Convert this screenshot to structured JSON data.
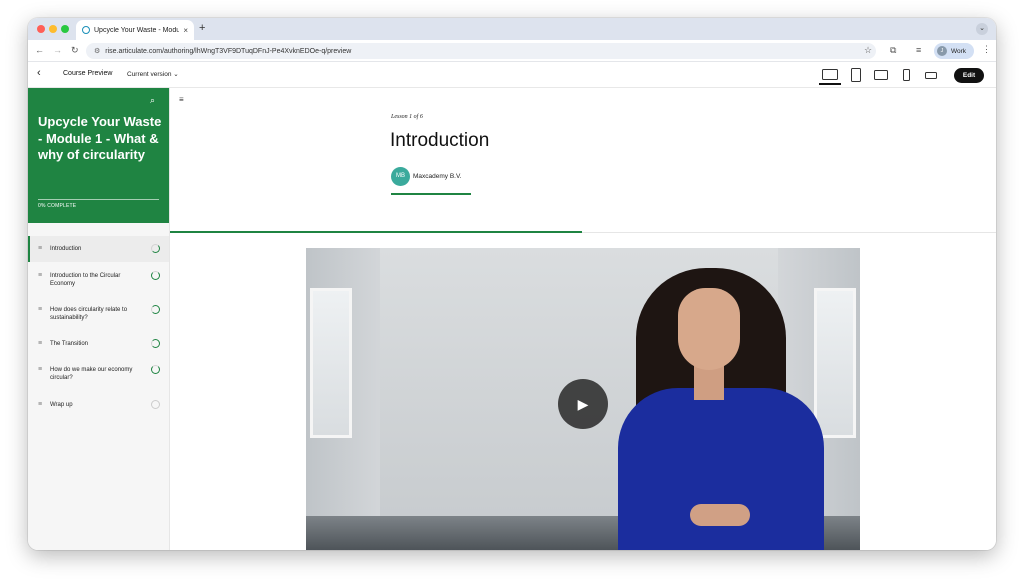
{
  "browser": {
    "tab_title": "Upcycle Your Waste - Module 1 - What & why of circularity",
    "tab_close": "×",
    "new_tab": "+",
    "url": "rise.articulate.com/authoring/lhWngT3VF9DTuqDFnJ-Pe4XvknEDOe-q/preview",
    "profile_initial": "J",
    "profile_name": "Work"
  },
  "app_header": {
    "title": "Course Preview",
    "version": "Current version",
    "edit_label": "Edit",
    "devices": [
      "desktop",
      "tablet-portrait",
      "tablet-landscape",
      "phone-portrait",
      "phone-landscape"
    ]
  },
  "sidebar": {
    "course_title": "Upcycle Your Waste - Module 1 - What & why of circularity",
    "progress": "0% COMPLETE",
    "progress_value": 0,
    "lessons": [
      {
        "label": "Introduction",
        "active": true
      },
      {
        "label": "Introduction to the Circular Economy"
      },
      {
        "label": "How does circularity relate to sustainability?"
      },
      {
        "label": "The Transition"
      },
      {
        "label": "How do we make our economy circular?"
      },
      {
        "label": "Wrap up"
      }
    ]
  },
  "lesson": {
    "count": "Lesson 1 of 6",
    "title": "Introduction",
    "author_initials": "MB",
    "author_name": "Maxcademy B.V."
  },
  "colors": {
    "brand_green": "#1f8442",
    "avatar_teal": "#3aaa9c"
  }
}
